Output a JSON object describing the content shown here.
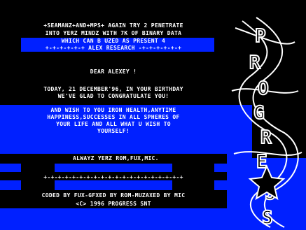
{
  "demo": {
    "greeting_lines": [
      "+SEAMANZ+AND+MPS+ AGAIN TRY 2 PENETRATE",
      "INTO YERZ MINDZ WITH 7K OF BINARY DATA",
      "WHICH CAN B UZED AS PRESENT 4"
    ],
    "recipient_rule": "+-+-+-+-+-+ ALEX RESEARCH -+-+-+-+-+-+",
    "salutation": "DEAR ALEXEY !",
    "message_lines": [
      "TODAY, 21 DECEMBER'96, IN YOUR BIRTHDAY",
      "WE'VE GLAD TO CONGRATULATE YOU!",
      "AND WISH TO YOU IRON HEALTH,ANYTIME",
      "HAPPINESS,SUCCESSES IN ALL SPHERES OF",
      "YOUR LIFE AND ALL WHAT U WISH TO",
      "YOURSELF!"
    ],
    "signature": "ALWAYZ YERZ ROM,FUX,MIC.",
    "separator_rule": "+-+-+-+-+-+-+-+-+-+-+-+-+-+-+-+-+-+-+-+",
    "credits": "CODED BY FUX-GFXED BY ROM-MUZAXED BY MIC",
    "copyright": "<C> 1996 PROGRESS SNT",
    "logo_text": "PROGRESS",
    "colors": {
      "blue": "#0020ff",
      "black": "#000000",
      "white": "#ffffff"
    }
  }
}
